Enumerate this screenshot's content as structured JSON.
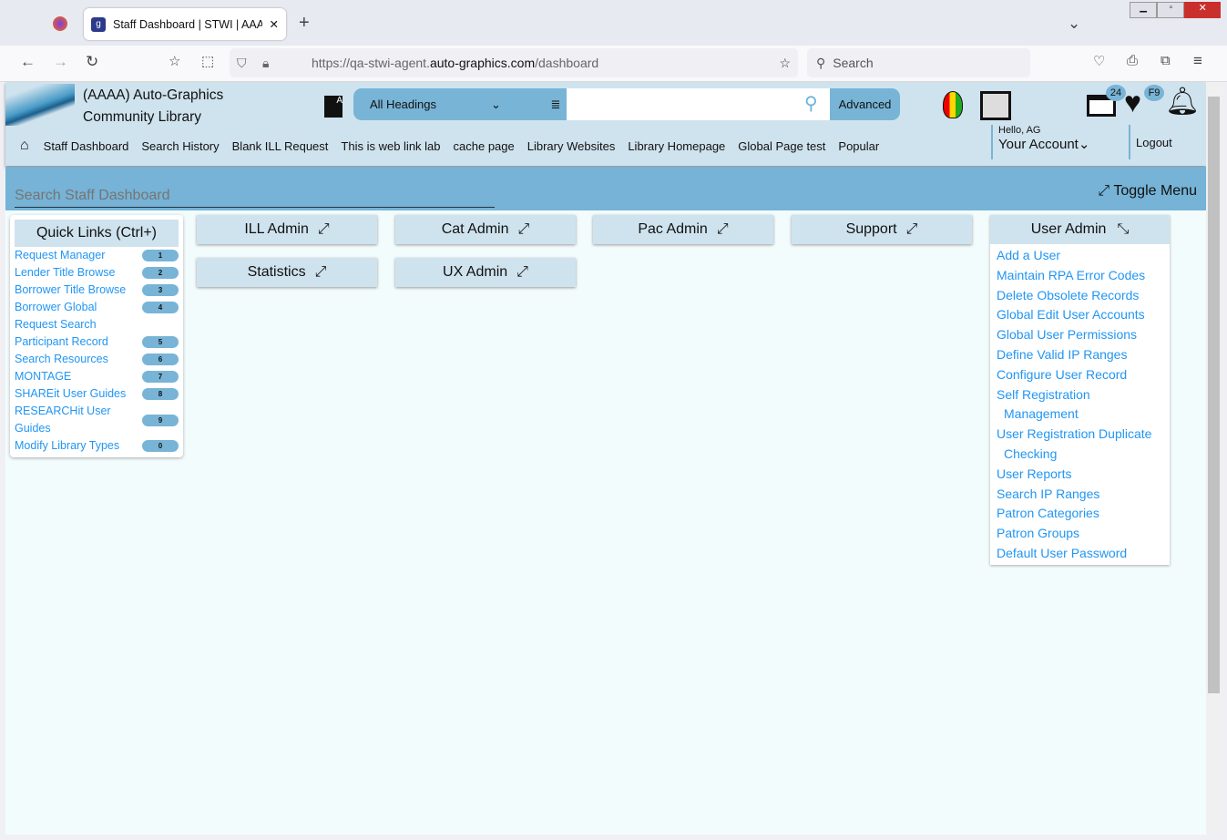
{
  "browser": {
    "tab_title": "Staff Dashboard | STWI | AAAA |",
    "url_prefix": "https://qa-stwi-agent.",
    "url_domain": "auto-graphics.com",
    "url_path": "/dashboard",
    "search_placeholder": "Search"
  },
  "header": {
    "library_line1": "(AAAA) Auto-Graphics",
    "library_line2": "Community Library",
    "search_scope": "All Headings",
    "advanced": "Advanced",
    "badge_list": "24",
    "badge_fav": "F9",
    "hello": "Hello, AG",
    "account": "Your Account",
    "logout": "Logout"
  },
  "menu": [
    "Staff Dashboard",
    "Search History",
    "Blank ILL Request",
    "This is web link lab",
    "cache page",
    "Library Websites",
    "Library Homepage",
    "Global Page test",
    "Popular"
  ],
  "band": {
    "search_placeholder": "Search Staff Dashboard",
    "toggle": "Toggle Menu"
  },
  "quick_links": {
    "title": "Quick Links (Ctrl+)",
    "items": [
      {
        "label": "Request Manager",
        "key": "1"
      },
      {
        "label": "Lender Title Browse",
        "key": "2"
      },
      {
        "label": "Borrower Title Browse",
        "key": "3"
      },
      {
        "label": "Borrower Global",
        "key": "4"
      },
      {
        "label": "Request Search",
        "key": ""
      },
      {
        "label": "Participant Record",
        "key": "5"
      },
      {
        "label": "Search Resources",
        "key": "6"
      },
      {
        "label": "MONTAGE",
        "key": "7"
      },
      {
        "label": "SHAREit User Guides",
        "key": "8"
      },
      {
        "label": "RESEARCHit User Guides",
        "key": "9"
      },
      {
        "label": "Modify Library Types",
        "key": "0"
      }
    ]
  },
  "admin_buttons": [
    "ILL Admin",
    "Cat Admin",
    "Pac Admin",
    "Support",
    "Statistics",
    "UX Admin"
  ],
  "user_admin": {
    "title": "User Admin",
    "links": [
      "Add a User",
      "Maintain RPA Error Codes",
      "Delete Obsolete Records",
      "Global Edit User Accounts",
      "Global User Permissions",
      "Define Valid IP Ranges",
      "Configure User Record",
      "Self Registration Management",
      "User Registration Duplicate Checking",
      "User Reports",
      "Search IP Ranges",
      "Patron Categories",
      "Patron Groups",
      "Default User Password"
    ]
  }
}
